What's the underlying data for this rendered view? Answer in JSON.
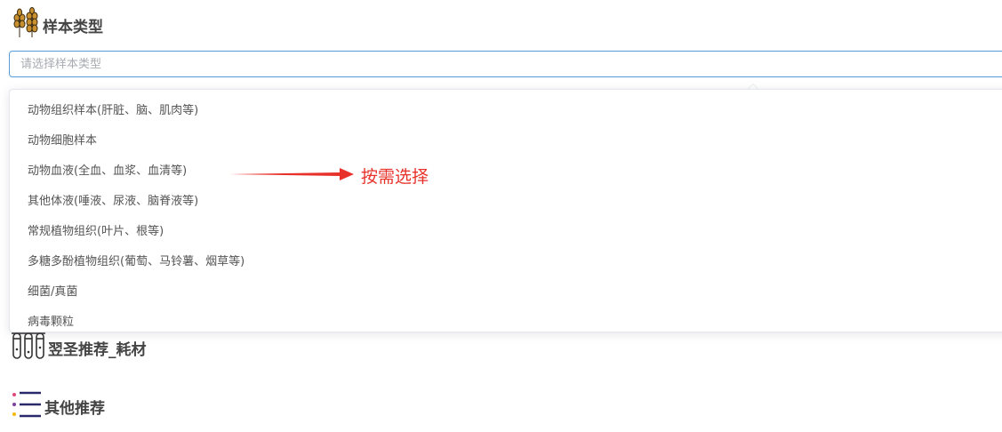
{
  "sections": {
    "sample_type": {
      "title": "样本类型",
      "icon": "wheat-icon"
    },
    "consumables": {
      "title": "翌圣推荐_耗材",
      "icon": "test-tubes-icon"
    },
    "other": {
      "title": "其他推荐",
      "icon": "list-icon"
    }
  },
  "select": {
    "placeholder": "请选择样本类型",
    "value": ""
  },
  "dropdown": {
    "options": [
      "动物组织样本(肝脏、脑、肌肉等)",
      "动物细胞样本",
      "动物血液(全血、血浆、血清等)",
      "其他体液(唾液、尿液、脑脊液等)",
      "常规植物组织(叶片、根等)",
      "多糖多酚植物组织(葡萄、马铃薯、烟草等)",
      "细菌/真菌",
      "病毒颗粒"
    ]
  },
  "annotation": {
    "text": "按需选择",
    "color": "#e8312a"
  },
  "colors": {
    "input_border": "#5b9bd5",
    "wheat": "#c8902e",
    "list_accent": "#e0457b"
  }
}
